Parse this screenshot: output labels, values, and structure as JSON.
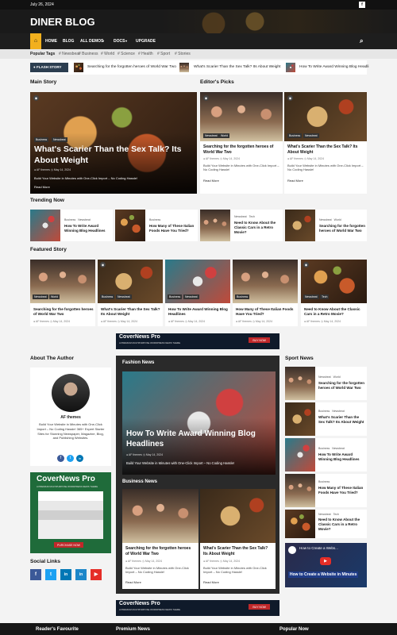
{
  "topbar": {
    "date": "July 26, 2024",
    "fb_icon": "f"
  },
  "site": {
    "title": "DINER BLOG"
  },
  "nav": {
    "home_icon": "home-icon",
    "items": [
      "HOME",
      "BLOG",
      "ALL DEMOS",
      "DOCS",
      "UPGRADE"
    ],
    "chevron": "▾",
    "search_icon": "⌕"
  },
  "tags": {
    "label": "Popular Tags",
    "items": [
      "# Newsbeat",
      "# Business",
      "# World",
      "# Science",
      "# Health",
      "# Sport",
      "# Stories"
    ]
  },
  "ticker": {
    "label": "FLASH STORY",
    "items": [
      "Searching for the forgotten heroes of World War Two",
      "What's Scarier Than the Sex Talk? Its About Weight",
      "How To Write Award Winning Blog Headli"
    ]
  },
  "main_story": {
    "heading": "Main Story",
    "cats": [
      "Business",
      "Newsbeat"
    ],
    "title": "What's Scarier Than the Sex Talk? Its About Weight",
    "author": "AF themes",
    "date": "May 14, 2024",
    "excerpt": "Build Your Website in Minutes with One-Click Import – No Coding Hassle!",
    "read_more": "Read More",
    "badge": "◉"
  },
  "editors_picks": {
    "heading": "Editor's Picks",
    "items": [
      {
        "cats": [
          "Newsbeat",
          "World"
        ],
        "title": "Searching for the forgotten heroes of World War Two",
        "author": "AF themes",
        "date": "May 14, 2024",
        "excerpt": "Build Your Website in Minutes with One-Click Import – No Coding Hassle!",
        "read_more": "Read More"
      },
      {
        "cats": [
          "Business",
          "Newsbeat"
        ],
        "title": "What's Scarier Than the Sex Talk? Its About Weight",
        "author": "AF themes",
        "date": "May 14, 2024",
        "excerpt": "Build Your Website in Minutes with One-Click Import – No Coding Hassle!",
        "read_more": "Read More"
      }
    ]
  },
  "trending": {
    "heading": "Trending Now",
    "items": [
      {
        "cats": [
          "Business",
          "Newsbeat"
        ],
        "title": "How To Write Award Winning Blog Headlines"
      },
      {
        "cats": [
          "Business"
        ],
        "title": "How Many of These Italian Foods Have You Tried?"
      },
      {
        "cats": [
          "Newsbeat",
          "Tech"
        ],
        "title": "Need to Know About the Classic Cars in a Retro Movie?"
      },
      {
        "cats": [
          "Newsbeat",
          "World"
        ],
        "title": "Searching for the forgotten heroes of World War Two"
      }
    ]
  },
  "featured": {
    "heading": "Featured Story",
    "items": [
      {
        "cats": [
          "Newsbeat",
          "World"
        ],
        "title": "Searching for the forgotten heroes of World War Two",
        "author": "AF themes",
        "date": "May 14, 2024"
      },
      {
        "cats": [
          "Business",
          "Newsbeat"
        ],
        "title": "What's Scarier Than the Sex Talk? Its About Weight",
        "author": "AF themes",
        "date": "May 14, 2024"
      },
      {
        "cats": [
          "Business",
          "Newsbeat"
        ],
        "title": "How To Write Award Winning Blog Headlines",
        "author": "AF themes",
        "date": "May 14, 2024"
      },
      {
        "cats": [
          "Business"
        ],
        "title": "How Many of These Italian Foods Have You Tried?",
        "author": "AF themes",
        "date": "May 14, 2024"
      },
      {
        "cats": [
          "Newsbeat",
          "Tech"
        ],
        "title": "Need to Know About the Classic Cars in a Retro Movie?",
        "author": "AF themes",
        "date": "May 14, 2024"
      }
    ]
  },
  "ad": {
    "title": "CoverNews Pro",
    "subtitle": "A PREMIUM MULTIPURPOSE WORDPRESS NEWS THEME",
    "button": "BUY NOW",
    "purchase": "PURCHASE NOW"
  },
  "author": {
    "heading": "About The Author",
    "name": "AF themes",
    "bio": "Build Your Website in Minutes with One-Click Import – No Coding Hassle! 365+ Expert Starter Sites for Stunning Newspaper, Magazine, Blog, and Publishing Websites.",
    "socials": [
      "f",
      "t",
      "in"
    ]
  },
  "social_links": {
    "heading": "Social Links",
    "items": [
      "f",
      "t",
      "in",
      "▶"
    ]
  },
  "fashion": {
    "heading": "Fashion News",
    "title": "How To Write Award Winning Blog Headlines",
    "author": "AF themes",
    "date": "May 14, 2024",
    "excerpt": "Build Your Website in Minutes with One-Click Import – No Coding Hassle!"
  },
  "business_news": {
    "heading": "Business News",
    "items": [
      {
        "title": "Searching for the forgotten heroes of World War Two",
        "author": "AF themes",
        "date": "May 14, 2024",
        "excerpt": "Build Your Website in Minutes with One-Click Import – No Coding Hassle!",
        "read_more": "Read More"
      },
      {
        "title": "What's Scarier Than the Sex Talk? Its About Weight",
        "author": "AF themes",
        "date": "May 14, 2024",
        "excerpt": "Build Your Website in Minutes with One-Click Import – No Coding Hassle!",
        "read_more": "Read More"
      }
    ]
  },
  "sport": {
    "heading": "Sport News",
    "items": [
      {
        "cats": [
          "Newsbeat",
          "World"
        ],
        "title": "Searching for the forgotten heroes of World War Two"
      },
      {
        "cats": [
          "Business",
          "Newsbeat"
        ],
        "title": "What's Scarier Than the Sex Talk? Its About Weight"
      },
      {
        "cats": [
          "Business",
          "Newsbeat"
        ],
        "title": "How To Write Award Winning Blog Headlines"
      },
      {
        "cats": [
          "Business"
        ],
        "title": "How Many of These Italian Foods Have You Tried?"
      },
      {
        "cats": [
          "Newsbeat",
          "Tech"
        ],
        "title": "Need to Know About the Classic Cars in a Retro Movie?"
      }
    ],
    "video_title": "How to Create a Website in Minutes",
    "video_top": "How to Create a Webs..."
  },
  "footer": {
    "cols": [
      "Reader's Favourite",
      "Premium News",
      "Popular Now"
    ]
  },
  "colors": {
    "accent": "#f2b01e",
    "dark": "#1e1e1e",
    "ad_red": "#c0282a"
  }
}
